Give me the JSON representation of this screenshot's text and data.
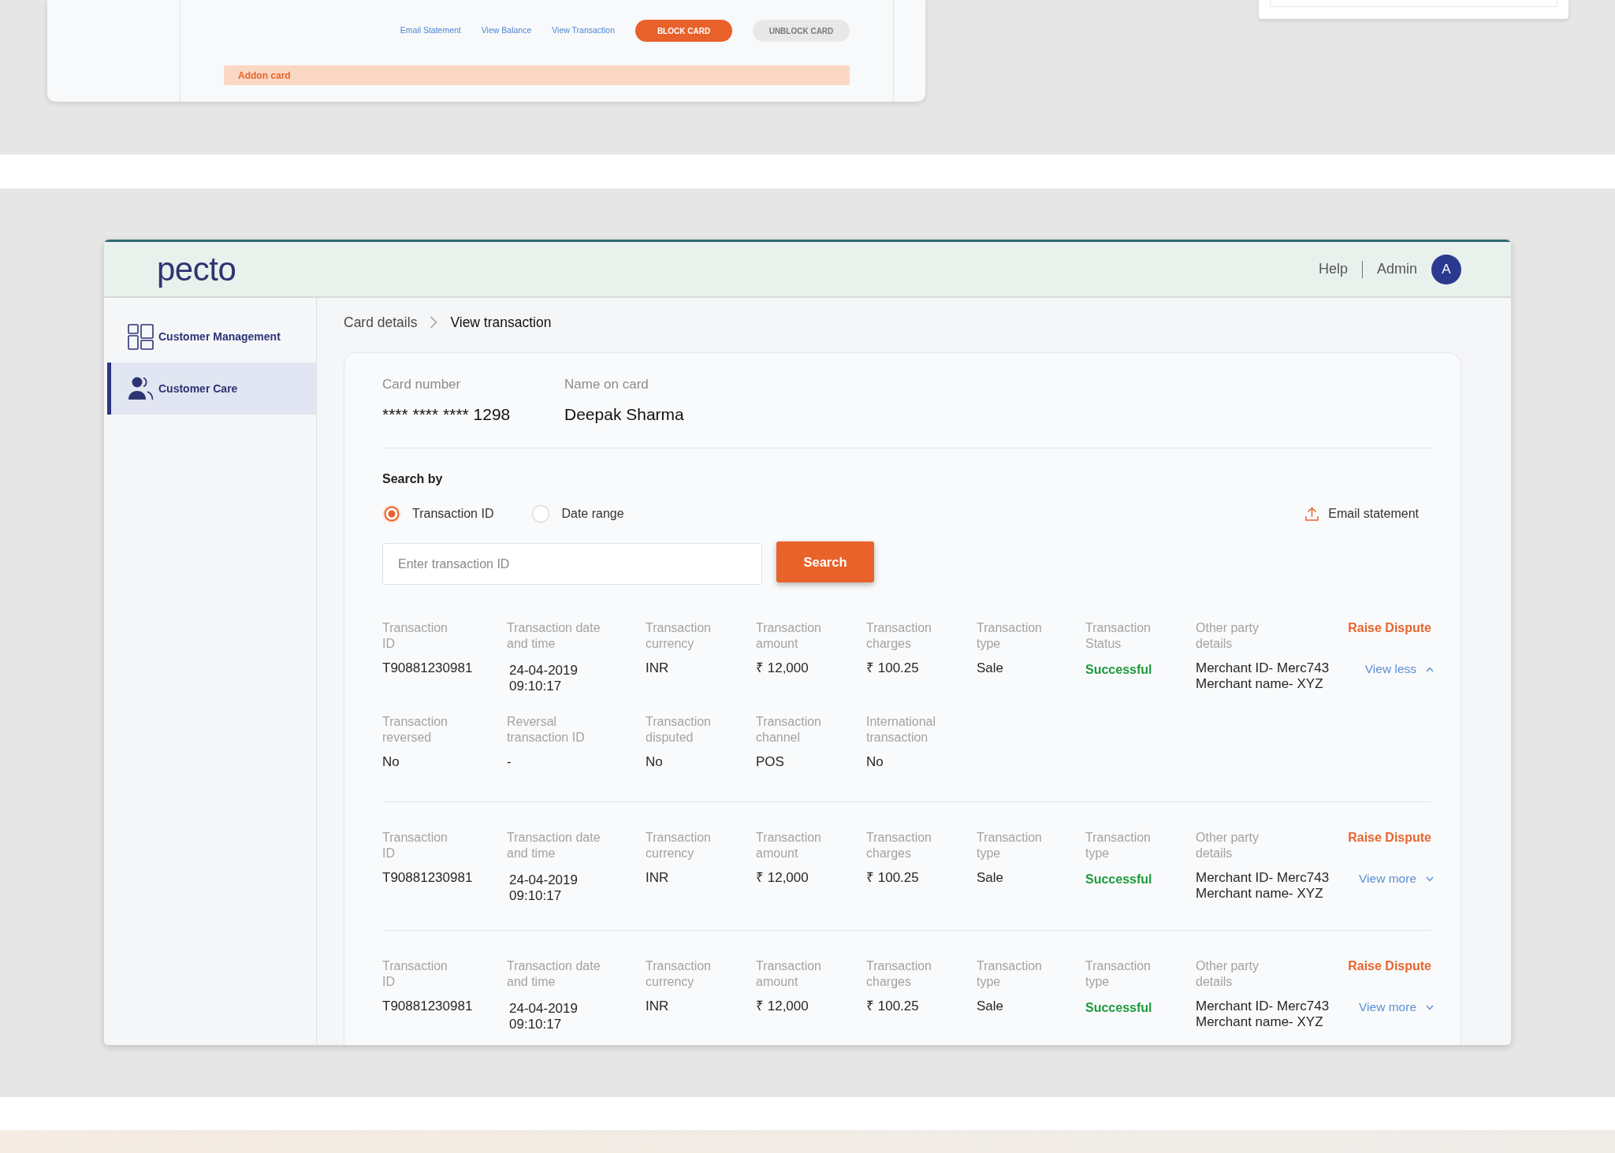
{
  "preview_card": {
    "actions": [
      {
        "kind": "link",
        "label": "Email Statement"
      },
      {
        "kind": "link",
        "label": "View Balance"
      },
      {
        "kind": "link",
        "label": "View Transaction"
      },
      {
        "kind": "pill",
        "label": "BLOCK CARD",
        "disabled": false
      },
      {
        "kind": "pill",
        "label": "UNBLOCK CARD",
        "disabled": true
      }
    ],
    "section_title": "Addon card"
  },
  "window": {
    "header": {
      "logo": "pecto",
      "links": [
        {
          "label": "Help"
        },
        {
          "label": "Admin"
        }
      ],
      "avatar": "A"
    },
    "sidebar": {
      "items": [
        {
          "label": "Customer Management",
          "selected": false
        },
        {
          "label": "Customer Care",
          "selected": true
        }
      ]
    },
    "breadcrumb": [
      {
        "label": "Card details",
        "current": false
      },
      {
        "label": "View transaction",
        "current": true
      }
    ],
    "card_info": [
      {
        "label": "Card number",
        "value": "**** **** **** 1298"
      },
      {
        "label": "Name on card",
        "value": "Deepak Sharma"
      }
    ],
    "search": {
      "title": "Search by",
      "options": [
        {
          "label": "Transaction ID",
          "selected": true
        },
        {
          "label": "Date range",
          "selected": false
        }
      ],
      "email_statement": "Email statement",
      "input": {
        "placeholder": "Enter transaction ID"
      },
      "button": "Search"
    },
    "transactions": [
      {
        "fields": [
          {
            "kind": "text",
            "label": "Transaction\nID",
            "value": "T90881230981"
          },
          {
            "kind": "datetime",
            "label": "Transaction date\nand time",
            "value": "24-04-2019\n09:10:17"
          },
          {
            "kind": "text",
            "label": "Transaction\ncurrency",
            "value": "INR"
          },
          {
            "kind": "text",
            "label": "Transaction\namount",
            "value": "₹ 12,000"
          },
          {
            "kind": "text",
            "label": "Transaction\ncharges",
            "value": "₹ 100.25"
          },
          {
            "kind": "text",
            "label": "Transaction\ntype",
            "value": "Sale"
          },
          {
            "kind": "status",
            "label": "Transaction\nStatus",
            "value": "Successful"
          },
          {
            "kind": "text",
            "label": "Other party\ndetails",
            "value": "Merchant ID- Merc743\nMerchant name- XYZ"
          }
        ],
        "raise_dispute": "Raise Dispute",
        "toggle": {
          "label": "View less",
          "expanded": true
        },
        "extra_fields": [
          {
            "label": "Transaction\nreversed",
            "value": "No"
          },
          {
            "label": "Reversal\ntransaction ID",
            "value": "-"
          },
          {
            "label": "Transaction\ndisputed",
            "value": "No"
          },
          {
            "label": "Transaction\nchannel",
            "value": "POS"
          },
          {
            "label": "International\ntransaction",
            "value": "No"
          }
        ]
      },
      {
        "fields": [
          {
            "kind": "text",
            "label": "Transaction\nID",
            "value": "T90881230981"
          },
          {
            "kind": "datetime",
            "label": "Transaction date\nand time",
            "value": "24-04-2019\n09:10:17"
          },
          {
            "kind": "text",
            "label": "Transaction\ncurrency",
            "value": "INR"
          },
          {
            "kind": "text",
            "label": "Transaction\namount",
            "value": "₹ 12,000"
          },
          {
            "kind": "text",
            "label": "Transaction\ncharges",
            "value": "₹ 100.25"
          },
          {
            "kind": "text",
            "label": "Transaction\ntype",
            "value": "Sale"
          },
          {
            "kind": "status",
            "label": "Transaction\ntype",
            "value": "Successful"
          },
          {
            "kind": "text",
            "label": "Other party\ndetails",
            "value": "Merchant ID- Merc743\nMerchant name- XYZ"
          }
        ],
        "raise_dispute": "Raise Dispute",
        "toggle": {
          "label": "View more",
          "expanded": false
        }
      },
      {
        "fields": [
          {
            "kind": "text",
            "label": "Transaction\nID",
            "value": "T90881230981"
          },
          {
            "kind": "datetime",
            "label": "Transaction date\nand time",
            "value": "24-04-2019\n09:10:17"
          },
          {
            "kind": "text",
            "label": "Transaction\ncurrency",
            "value": "INR"
          },
          {
            "kind": "text",
            "label": "Transaction\namount",
            "value": "₹ 12,000"
          },
          {
            "kind": "text",
            "label": "Transaction\ncharges",
            "value": "₹ 100.25"
          },
          {
            "kind": "text",
            "label": "Transaction\ntype",
            "value": "Sale"
          },
          {
            "kind": "status",
            "label": "Transaction\ntype",
            "value": "Successful"
          },
          {
            "kind": "text",
            "label": "Other party\ndetails",
            "value": "Merchant ID- Merc743\nMerchant name- XYZ"
          }
        ],
        "raise_dispute": "Raise Dispute",
        "toggle": {
          "label": "View more",
          "expanded": false
        }
      }
    ]
  }
}
